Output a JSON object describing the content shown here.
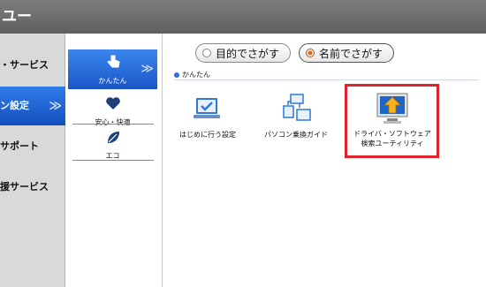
{
  "window": {
    "title": "ユー"
  },
  "left_nav": {
    "items": [
      {
        "label": "・サービス"
      },
      {
        "label": "ン設定"
      },
      {
        "label": "サポート"
      },
      {
        "label": "援サービス"
      }
    ],
    "active_chevron": "≫"
  },
  "category_nav": {
    "items": [
      {
        "label": "かんたん",
        "icon": "hand-pointer-icon"
      },
      {
        "label": "安心・快適",
        "icon": "heart-icon"
      },
      {
        "label": "エコ",
        "icon": "leaf-icon"
      }
    ],
    "active_chevron": "≫"
  },
  "search_mode": {
    "options": [
      {
        "label": "目的でさがす",
        "selected": false
      },
      {
        "label": "名前でさがす",
        "selected": true
      }
    ]
  },
  "section": {
    "title": "かんたん"
  },
  "apps": [
    {
      "label": "はじめに行う設定",
      "icon": "laptop-check-icon"
    },
    {
      "label": "パソコン乗換ガイド",
      "icon": "pc-transfer-icon"
    },
    {
      "label_line1": "ドライバ・ソフトウェア",
      "label_line2": "検索ユーティリティ",
      "icon": "driver-search-icon"
    }
  ],
  "colors": {
    "highlight": "#e0232a",
    "active_blue": "#1a56c7",
    "titlebar": "#6e6e6e"
  }
}
